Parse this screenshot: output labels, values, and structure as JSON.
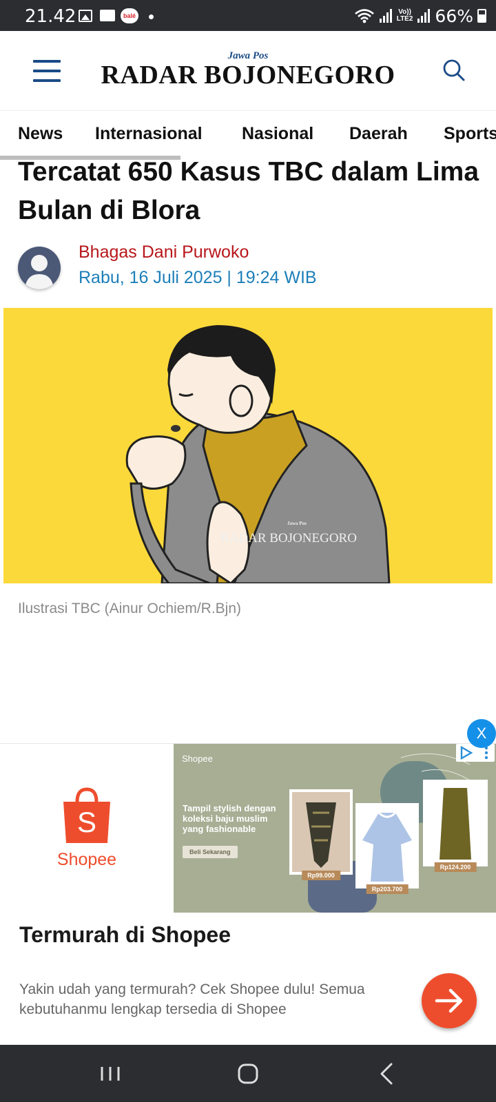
{
  "status_bar": {
    "time": "21.42",
    "bale_label": "balé",
    "volte_top": "Vo))",
    "volte_bottom": "LTE2",
    "battery": "66%"
  },
  "header": {
    "logo_small": "Jawa Pos",
    "logo_big": "RADAR BOJONEGORO"
  },
  "nav": {
    "items": [
      "News",
      "Internasional",
      "Nasional",
      "Daerah",
      "Sports"
    ],
    "active": "News"
  },
  "article": {
    "title": "Tercatat 650 Kasus TBC dalam Lima Bulan di Blora",
    "author": "Bhagas Dani Purwoko",
    "date": "Rabu, 16 Juli 2025 | 19:24 WIB",
    "image_watermark_small": "Jawa Pos",
    "image_watermark": "RADAR BOJONEGORO",
    "caption": "Ilustrasi TBC (Ainur Ochiem/R.Bjn)"
  },
  "ad": {
    "close_label": "X",
    "brand": "Shopee",
    "banner": {
      "brand": "Shopee",
      "tagline": "Tampil stylish dengan koleksi baju muslim yang fashionable",
      "cta": "Beli Sekarang",
      "prices": [
        "Rp99.000",
        "Rp203.700",
        "Rp124.200"
      ]
    },
    "title": "Termurah di Shopee",
    "description": "Yakin udah yang termurah? Cek Shopee dulu! Semua kebutuhanmu lengkap tersedia di Shopee"
  },
  "colors": {
    "brand_blue": "#1a4b86",
    "author_red": "#b8161b",
    "date_blue": "#1d7fb8",
    "image_bg": "#fcd93a",
    "shopee_orange": "#ee4d2d",
    "system_bar": "#2b2d31"
  }
}
